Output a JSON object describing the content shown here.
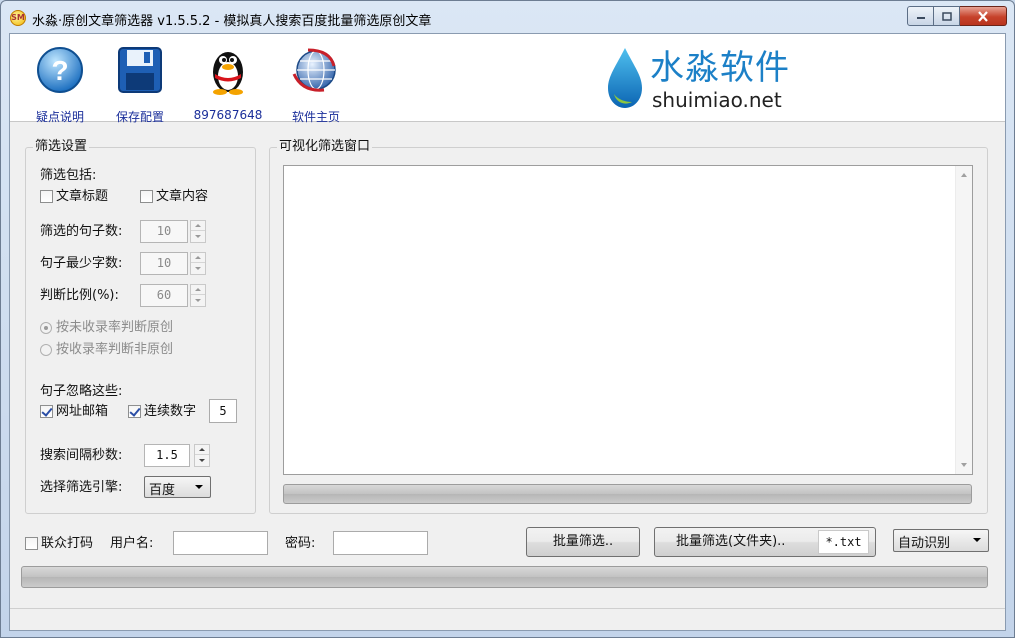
{
  "window": {
    "title": "水淼·原创文章筛选器 v1.5.5.2 - 模拟真人搜索百度批量筛选原创文章",
    "icon_text": "SM"
  },
  "toolbar": {
    "help_label": "疑点说明",
    "save_label": "保存配置",
    "qq_label": "897687648",
    "home_label": "软件主页"
  },
  "logo": {
    "cn": "水淼软件",
    "en": "shuimiao.net",
    "color": "#1c80c7"
  },
  "settings": {
    "title": "筛选设置",
    "include_label": "筛选包括:",
    "include_title": {
      "label": "文章标题",
      "checked": false
    },
    "include_content": {
      "label": "文章内容",
      "checked": false
    },
    "sentence_count": {
      "label": "筛选的句子数:",
      "value": "10"
    },
    "min_chars": {
      "label": "句子最少字数:",
      "value": "10"
    },
    "ratio": {
      "label": "判断比例(%):",
      "value": "60"
    },
    "radio_unindexed": {
      "label": "按未收录率判断原创",
      "checked": true
    },
    "radio_indexed": {
      "label": "按收录率判断非原创",
      "checked": false
    },
    "ignore_label": "句子忽略这些:",
    "ignore_url": {
      "label": "网址邮箱",
      "checked": true
    },
    "ignore_digits": {
      "label": "连续数字",
      "checked": true,
      "value": "5"
    },
    "interval": {
      "label": "搜索间隔秒数:",
      "value": "1.5"
    },
    "engine": {
      "label": "选择筛选引擎:",
      "value": "百度"
    }
  },
  "visual": {
    "title": "可视化筛选窗口"
  },
  "bottom": {
    "lianzhong": {
      "label": "联众打码",
      "checked": false
    },
    "username_label": "用户名:",
    "username_value": "",
    "password_label": "密码:",
    "password_value": "",
    "batch_button": "批量筛选..",
    "batch_folder_button": "批量筛选(文件夹)..",
    "file_pattern": "*.txt",
    "mode": "自动识别"
  }
}
